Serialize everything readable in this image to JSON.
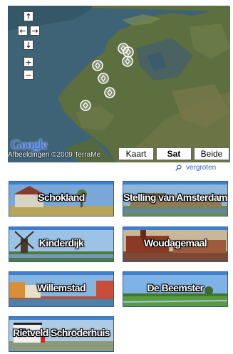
{
  "map": {
    "copyright": "Afbeeldingen ©2009 TerraMe",
    "google_logo": "Google",
    "map_types": [
      {
        "label": "Kaart",
        "active": false
      },
      {
        "label": "Sat",
        "active": true
      },
      {
        "label": "Beide",
        "active": false
      }
    ],
    "nav_icons": [
      "arrow-up-icon",
      "arrow-left-icon",
      "arrow-right-icon",
      "arrow-down-icon",
      "zoom-in-icon",
      "zoom-out-icon"
    ],
    "nav_glyphs": {
      "up": "↑",
      "left": "←",
      "right": "→",
      "down": "↓",
      "zoom_in": "+",
      "zoom_out": "−"
    },
    "marker_count": 7
  },
  "enlarge": {
    "label": "vergroten",
    "icon": "magnifier-icon"
  },
  "tiles": [
    {
      "label": "Schokland",
      "theme": "church",
      "sky": "#7aa7d8",
      "ground": "#b7a35a"
    },
    {
      "label": "Stelling van Amsterdam",
      "theme": "fort",
      "sky": "#8fb6d9",
      "ground": "#6d8a4a"
    },
    {
      "label": "Kinderdijk",
      "theme": "windmill",
      "sky": "#9cc2e6",
      "ground": "#4f7a3a"
    },
    {
      "label": "Woudagemaal",
      "theme": "pumping-station",
      "sky": "#c9b79a",
      "ground": "#7a4a36"
    },
    {
      "label": "Willemstad",
      "theme": "harbor",
      "sky": "#86b5e0",
      "ground": "#b0523c"
    },
    {
      "label": "De Beemster",
      "theme": "polder",
      "sky": "#7fb3e8",
      "ground": "#5b9a3a"
    },
    {
      "label": "Rietveld Schröderhuis",
      "theme": "house",
      "sky": "#aecbe3",
      "ground": "#8a9a7a"
    }
  ],
  "colors": {
    "accent": "#3d7fd0",
    "link": "#3366bb"
  }
}
